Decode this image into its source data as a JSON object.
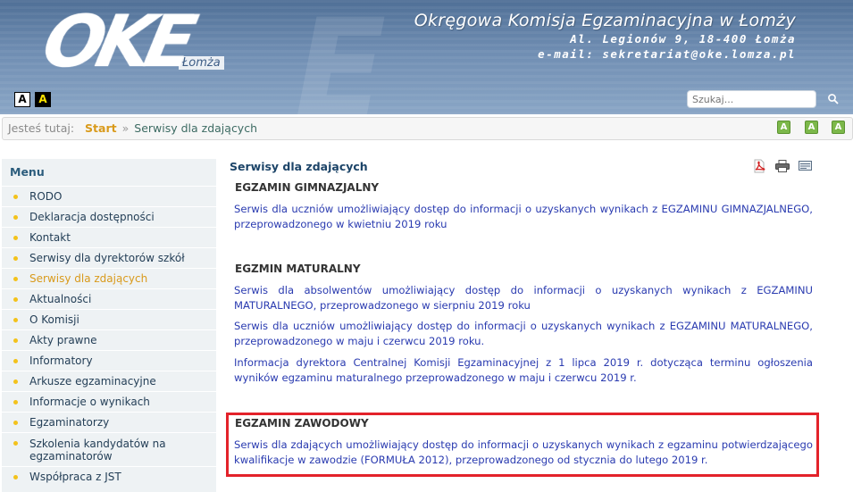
{
  "header": {
    "logo_text": "OKE",
    "logo_city": "Łomża",
    "org_name": "Okręgowa Komisja Egzaminacyjna w Łomży",
    "address": "Al. Legionów 9, 18-400 Łomża",
    "email": "e-mail: sekretariat@oke.lomza.pl",
    "contrast_normal": "A",
    "contrast_high": "A",
    "search_placeholder": "Szukaj..."
  },
  "breadcrumb": {
    "label": "Jesteś tutaj:",
    "start": "Start",
    "separator": "»",
    "current": "Serwisy dla zdających"
  },
  "font_buttons": [
    "A",
    "A",
    "A"
  ],
  "sidebar": {
    "title": "Menu",
    "items": [
      {
        "label": "RODO"
      },
      {
        "label": "Deklaracja dostępności"
      },
      {
        "label": "Kontakt"
      },
      {
        "label": "Serwisy dla dyrektorów szkół"
      },
      {
        "label": "Serwisy dla zdających"
      },
      {
        "label": "Aktualności"
      },
      {
        "label": "O Komisji"
      },
      {
        "label": "Akty prawne"
      },
      {
        "label": "Informatory"
      },
      {
        "label": "Arkusze egzaminacyjne"
      },
      {
        "label": "Informacje o wynikach"
      },
      {
        "label": "Egzaminatorzy"
      },
      {
        "label": "Szkolenia kandydatów na egzaminatorów"
      },
      {
        "label": "Współpraca z JST"
      }
    ],
    "active_index": 4
  },
  "main": {
    "page_title": "Serwisy dla zdających",
    "tool_icons": [
      "pdf-icon",
      "print-icon",
      "email-icon"
    ],
    "sections": [
      {
        "heading": "EGZAMIN GIMNAZJALNY",
        "links": [
          "Serwis dla uczniów umożliwiający dostęp do informacji o uzyskanych wynikach z EGZAMINU GIMNAZJALNEGO, przeprowadzonego w kwietniu 2019 roku"
        ]
      },
      {
        "heading": "EGZMIN MATURALNY",
        "links": [
          "Serwis dla absolwentów umożliwiający dostęp do informacji o uzyskanych wynikach z EGZAMINU MATURALNEGO, przeprowadzonego w sierpniu 2019 roku",
          "Serwis dla uczniów umożliwiający dostęp do informacji o uzyskanych wynikach z EGZAMINU MATURALNEGO, przeprowadzonego w maju i czerwcu 2019 roku.",
          "Informacja dyrektora Centralnej Komisji Egzaminacyjnej z 1 lipca 2019 r. dotycząca terminu ogłoszenia wyników egzaminu maturalnego przeprowadzonego w maju i czerwcu 2019 r."
        ]
      },
      {
        "heading": "EGZAMIN ZAWODOWY",
        "links": [
          "Serwis dla zdających umożliwiający dostęp do informacji o uzyskanych wynikach z egzaminu potwierdzającego kwalifikacje w zawodzie (FORMUŁA 2012), przeprowadzonego od stycznia do lutego 2019 r."
        ]
      }
    ]
  },
  "colors": {
    "highlight": "#e3222a",
    "link": "#2a3bb0",
    "active_menu": "#d99a1b",
    "bullet": "#f3c21b"
  }
}
